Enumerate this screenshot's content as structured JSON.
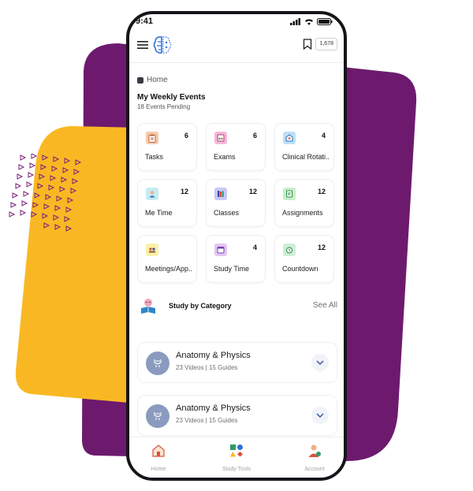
{
  "status_bar": {
    "time": "9:41"
  },
  "header": {
    "badge_count": "1,678"
  },
  "breadcrumb": {
    "label": "Home"
  },
  "events": {
    "title": "My Weekly Events",
    "subtitle": "18 Events Pending"
  },
  "tiles": [
    {
      "label": "Tasks",
      "count": "6",
      "icon": "clipboard-icon",
      "color": "#f7c9a8"
    },
    {
      "label": "Exams",
      "count": "6",
      "icon": "exam-icon",
      "color": "#f6b7d8"
    },
    {
      "label": "Clinical Rotati..",
      "count": "4",
      "icon": "hospital-icon",
      "color": "#bde0f8"
    },
    {
      "label": "Me Time",
      "count": "12",
      "icon": "person-icon",
      "color": "#c5ecf4"
    },
    {
      "label": "Classes",
      "count": "12",
      "icon": "books-icon",
      "color": "#c7c9f7"
    },
    {
      "label": "Assignments",
      "count": "12",
      "icon": "assignment-icon",
      "color": "#c6efc9"
    },
    {
      "label": "Meetings/App..",
      "count": "",
      "icon": "meeting-icon",
      "color": "#fbf0a8"
    },
    {
      "label": "Study Time",
      "count": "4",
      "icon": "calendar-icon",
      "color": "#e3c6f4"
    },
    {
      "label": "Countdown",
      "count": "12",
      "icon": "timer-icon",
      "color": "#cdeed6"
    }
  ],
  "category": {
    "title": "Study by Category",
    "see_all": "See All"
  },
  "cards": [
    {
      "name": "Anatomy & Physics",
      "meta": "23 Videos | 15 Guides"
    },
    {
      "name": "Anatomy & Physics",
      "meta": "23 Videos | 15 Guides"
    }
  ],
  "nav": [
    {
      "label": "Home",
      "icon": "home-icon"
    },
    {
      "label": "Study Tools",
      "icon": "shapes-icon"
    },
    {
      "label": "Account",
      "icon": "account-icon"
    }
  ],
  "colors": {
    "purple": "#6d1a6e",
    "yellow": "#f9b823",
    "accent_blue": "#2f6fdb"
  }
}
